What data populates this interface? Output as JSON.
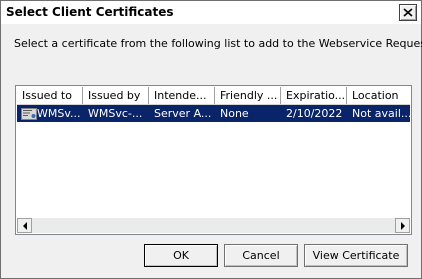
{
  "dialog": {
    "title": "Select Client Certificates",
    "instruction": "Select a certificate from the following list to add to the Webservice Request"
  },
  "table": {
    "columns": [
      "Issued to",
      "Issued by",
      "Intende...",
      "Friendly ...",
      "Expiratio...",
      "Location"
    ],
    "rows": [
      {
        "issued_to": "WMSv...",
        "issued_by": "WMSvc-...",
        "intended": "Server A...",
        "friendly": "None",
        "expiration": "2/10/2022",
        "location": "Not avail..."
      }
    ]
  },
  "buttons": {
    "ok": "OK",
    "cancel": "Cancel",
    "view": "View Certificate"
  },
  "icons": {
    "close": "close-icon",
    "certificate": "certificate-icon",
    "scroll_left": "scroll-left-icon",
    "scroll_right": "scroll-right-icon"
  },
  "colors": {
    "selection": "#0a246a",
    "dialog_bg": "#f0f0f0"
  }
}
